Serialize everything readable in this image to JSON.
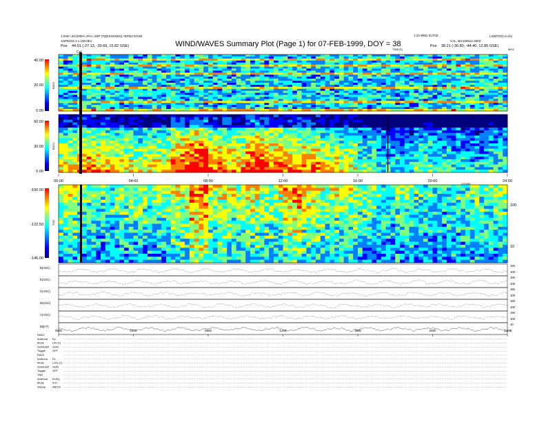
{
  "title": "WIND/WAVES Summary Plot (Page 1) for 07-FEB-1999, DOY = 38",
  "header": {
    "left1": "1.030<=EC2000<=PA<=3SP (TQEX2GSEN) <EPD2 EGSE",
    "left2": "ASPINGS 2 x 100.0E1",
    "left3_label": "Pos",
    "left3_value": "44.01 (-27.13, -30.69, 15.82 GSE)",
    "right1": "1.10 WED 2UT0Z",
    "right2": "CAL, BG100912-2002",
    "right3_label": "Pos",
    "right3_value": "38.21 (-30.80, -44.40, 12.85 GSE)",
    "far_right": "L2(BTOO) m=b1",
    "units_label": "MHZ",
    "time_label": "TIME(S)",
    "cal_marker": "Cal"
  },
  "panels": {
    "rad2": {
      "label": "RAD2",
      "ticks": [
        "40.00",
        "20.00",
        "0.00"
      ]
    },
    "rad1": {
      "label": "RAD1",
      "ticks": [
        "60.00",
        "30.00",
        "0.00"
      ]
    },
    "tnr": {
      "label": "TNR",
      "ticks": [
        "-100.00",
        "-122.50",
        "-145.00"
      ],
      "right_ticks": [
        "100",
        "10"
      ],
      "right_label": "kHz"
    }
  },
  "time_axis": {
    "ticks": [
      "00:00",
      "04:00",
      "08:00",
      "12:00",
      "16:00",
      "20:00",
      "24:00"
    ],
    "label": "UT(HR)"
  },
  "line_panels": [
    {
      "label": "B(AGC)",
      "values": [
        "150",
        "100"
      ]
    },
    {
      "label": "E(AGC)",
      "values": [
        "150",
        "100"
      ]
    },
    {
      "label": "C(AGC)",
      "values": [
        "150",
        "100"
      ]
    },
    {
      "label": "M(AGC)",
      "values": [
        "150",
        "100"
      ]
    },
    {
      "label": "A(AGC)",
      "values": [
        "150",
        "100"
      ]
    },
    {
      "label": "|B|(nT)",
      "values": [
        "10",
        "0"
      ]
    }
  ],
  "bottom_time_ticks": [
    "0000",
    "0400",
    "0800",
    "1200",
    "1600",
    "2000",
    "2400"
  ],
  "info_rows": [
    {
      "label": "RAD2"
    },
    {
      "label": "Antenna",
      "value": "Ey"
    },
    {
      "label": "Mode",
      "value": "LIN (1)"
    },
    {
      "label": "SUMGAP",
      "value": "SUM"
    },
    {
      "label": "Toggle",
      "value": "OFF"
    },
    {
      "label": "RAD1"
    },
    {
      "label": "Antenna",
      "value": "Ex"
    },
    {
      "label": "Mode",
      "value": "LOG (1)"
    },
    {
      "label": "SUMGAP",
      "value": "SUM"
    },
    {
      "label": "Toggle",
      "value": "OFF"
    },
    {
      "label": "TNR"
    },
    {
      "label": "Antenna",
      "value": "Ex/Ey"
    },
    {
      "label": "Mode",
      "value": "A-D"
    },
    {
      "label": "Sweep",
      "value": "AB/CD"
    }
  ],
  "colors": {
    "scale": [
      "#00007f",
      "#0000ff",
      "#0080ff",
      "#00ffff",
      "#80ff80",
      "#ffff00",
      "#ff8000",
      "#ff0000"
    ]
  },
  "chart_data": [
    {
      "type": "heatmap",
      "name": "RAD2",
      "ylabel": "RAD2",
      "ylim": [
        0,
        40
      ],
      "xlim": [
        "00:00",
        "24:00"
      ],
      "intensity_by_hour": [
        0.45,
        0.55,
        0.5,
        0.48,
        0.5,
        0.47,
        0.5,
        0.52,
        0.5,
        0.48,
        0.5,
        0.5,
        0.5,
        0.48,
        0.5,
        0.52,
        0.5,
        0.5,
        0.48,
        0.5,
        0.5,
        0.52,
        0.5,
        0.5
      ]
    },
    {
      "type": "heatmap",
      "name": "RAD1",
      "ylabel": "RAD1",
      "ylim": [
        0,
        60
      ],
      "xlim": [
        "00:00",
        "24:00"
      ],
      "intensity_by_hour": [
        0.6,
        0.7,
        0.65,
        0.6,
        0.55,
        0.6,
        0.75,
        0.85,
        0.7,
        0.65,
        0.8,
        0.75,
        0.7,
        0.7,
        0.6,
        0.55,
        0.45,
        0.35,
        0.35,
        0.45,
        0.4,
        0.35,
        0.35,
        0.4
      ]
    },
    {
      "type": "heatmap",
      "name": "TNR",
      "ylabel": "TNR",
      "ylim": [
        -145,
        -100
      ],
      "xlim": [
        "00:00",
        "24:00"
      ],
      "intensity_by_hour": [
        0.55,
        0.5,
        0.45,
        0.5,
        0.5,
        0.5,
        0.6,
        0.75,
        0.6,
        0.55,
        0.6,
        0.55,
        0.7,
        0.6,
        0.55,
        0.55,
        0.5,
        0.45,
        0.5,
        0.45,
        0.4,
        0.45,
        0.5,
        0.5
      ]
    }
  ]
}
